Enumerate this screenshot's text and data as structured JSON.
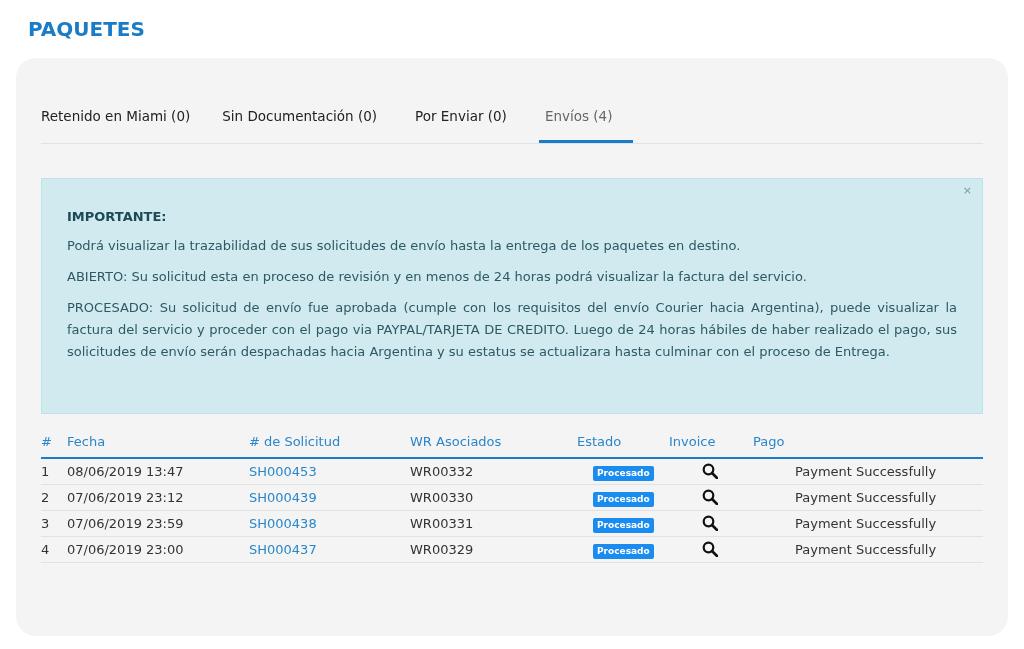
{
  "title": "PAQUETES",
  "tabs": [
    {
      "label": "Retenido en Miami (0)",
      "selected": false
    },
    {
      "label": "Sin Documentación (0)",
      "selected": false
    },
    {
      "label": "Por Enviar (0)",
      "selected": false
    },
    {
      "label": "Envíos (4)",
      "selected": true
    }
  ],
  "alert": {
    "close": "×",
    "heading": "IMPORTANTE:",
    "paragraphs": [
      "Podrá visualizar la trazabilidad de sus solicitudes de envío hasta la entrega de los paquetes en destino.",
      "ABIERTO: Su solicitud esta en proceso de revisión y en menos de 24 horas podrá visualizar la factura del servicio.",
      "PROCESADO: Su solicitud de envío fue aprobada (cumple con los requisitos del envío Courier hacia Argentina), puede visualizar la factura del servicio y proceder con el pago via PAYPAL/TARJETA DE CREDITO. Luego de 24 horas hábiles de haber realizado el pago, sus solicitudes de envío serán despachadas hacia Argentina y su estatus se actualizara hasta culminar con el proceso de Entrega."
    ]
  },
  "table": {
    "columns": [
      "#",
      "Fecha",
      "# de Solicitud",
      "WR Asociados",
      "Estado",
      "Invoice",
      "Pago"
    ],
    "rows": [
      {
        "num": "1",
        "date": "08/06/2019 13:47",
        "request": "SH000453",
        "wr": "WR00332",
        "status": {
          "label": "Procesado",
          "kind": "processed"
        },
        "payment": "Payment Successfully"
      },
      {
        "num": "2",
        "date": "07/06/2019 23:12",
        "request": "SH000439",
        "wr": "WR00330",
        "status": {
          "label": "Procesado",
          "kind": "processed"
        },
        "payment": "Payment Successfully"
      },
      {
        "num": "3",
        "date": "07/06/2019 23:59",
        "request": "SH000438",
        "wr": "WR00331",
        "status": {
          "label": "Procesado",
          "kind": "processed"
        },
        "payment": "Payment Successfully"
      },
      {
        "num": "4",
        "date": "07/06/2019 23:00",
        "request": "SH000437",
        "wr": "WR00329",
        "status": {
          "label": "Procesado",
          "kind": "processed"
        },
        "payment": "Payment Successfully"
      }
    ]
  }
}
